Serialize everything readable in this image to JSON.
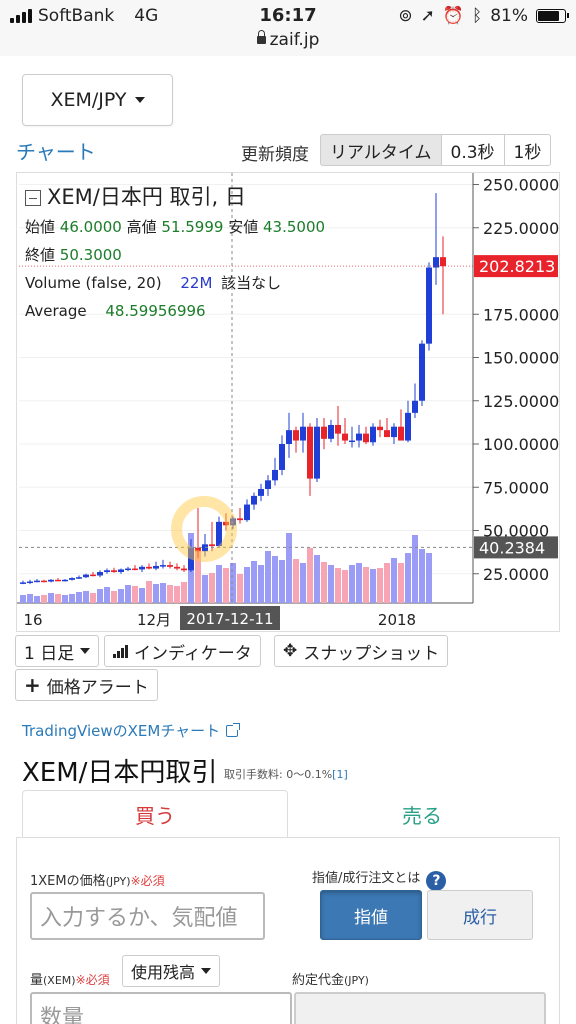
{
  "status_bar": {
    "carrier": "SoftBank",
    "network": "4G",
    "time": "16:17",
    "battery": "81%",
    "battery_level": 0.81,
    "url": "zaif.jp",
    "icons": [
      "signal-icon",
      "orientation-lock-icon",
      "location-icon",
      "alarm-icon",
      "bluetooth-icon",
      "battery-icon",
      "lock-icon"
    ]
  },
  "pair_select": {
    "value": "XEM/JPY"
  },
  "chart_header": {
    "chart_link": "チャート",
    "frequency_label": "更新頻度",
    "frequency_options": [
      "リアルタイム",
      "0.3秒",
      "1秒"
    ],
    "frequency_selected": "リアルタイム"
  },
  "legend": {
    "title": "XEM/日本円 取引, 日",
    "open_label": "始値",
    "open": "46.0000",
    "high_label": "高値",
    "high": "51.5999",
    "low_label": "安値",
    "low": "43.5000",
    "close_label": "終値",
    "close": "50.3000",
    "volume_label": "Volume (false, 20)",
    "volume": "22M",
    "volume_na": "該当なし",
    "average_label": "Average",
    "average": "48.59956996"
  },
  "chart_data": {
    "type": "candlestick",
    "x_ticks": [
      "16",
      "12月",
      "2017-12-11",
      "2018"
    ],
    "x_highlight": "2017-12-11",
    "y_ticks": [
      "250.0000",
      "225.0000",
      "175.0000",
      "150.0000",
      "125.0000",
      "100.0000",
      "75.0000",
      "50.0000",
      "25.0000"
    ],
    "ylim": [
      0,
      255
    ],
    "price_label": "202.8213",
    "price_line": 202.8213,
    "cursor_label": "40.2384",
    "cursor_line": 40.2384,
    "colors": {
      "up": "#1f3fd6",
      "down": "#e8232b",
      "vol_up": "#9a9cf5",
      "vol_down": "#f7a5b4",
      "price_label_bg": "#e8232b",
      "cursor_label_bg": "#555555"
    },
    "candles": [
      {
        "o": 20,
        "h": 21,
        "l": 19,
        "c": 20
      },
      {
        "o": 20,
        "h": 21.5,
        "l": 19,
        "c": 20.5
      },
      {
        "o": 20.5,
        "h": 22,
        "l": 20,
        "c": 21
      },
      {
        "o": 21,
        "h": 21.5,
        "l": 20,
        "c": 20.5
      },
      {
        "o": 20.5,
        "h": 22,
        "l": 20,
        "c": 21.5
      },
      {
        "o": 21.5,
        "h": 22.5,
        "l": 21,
        "c": 21
      },
      {
        "o": 21,
        "h": 22,
        "l": 20.5,
        "c": 21.5
      },
      {
        "o": 21.5,
        "h": 23,
        "l": 21,
        "c": 22.5
      },
      {
        "o": 22.5,
        "h": 24,
        "l": 22,
        "c": 23
      },
      {
        "o": 23,
        "h": 25,
        "l": 22.5,
        "c": 24.5
      },
      {
        "o": 24.5,
        "h": 26,
        "l": 23.5,
        "c": 24
      },
      {
        "o": 24,
        "h": 27,
        "l": 23,
        "c": 26
      },
      {
        "o": 26,
        "h": 28,
        "l": 25,
        "c": 27
      },
      {
        "o": 27,
        "h": 28.5,
        "l": 25.5,
        "c": 26
      },
      {
        "o": 26,
        "h": 28,
        "l": 25,
        "c": 27.5
      },
      {
        "o": 27.5,
        "h": 29,
        "l": 26.5,
        "c": 28
      },
      {
        "o": 28,
        "h": 30,
        "l": 27,
        "c": 27.5
      },
      {
        "o": 27.5,
        "h": 30,
        "l": 26,
        "c": 29
      },
      {
        "o": 29,
        "h": 31,
        "l": 27.5,
        "c": 28
      },
      {
        "o": 28,
        "h": 32,
        "l": 27,
        "c": 29.5
      },
      {
        "o": 29.5,
        "h": 33,
        "l": 28,
        "c": 30
      },
      {
        "o": 30,
        "h": 32,
        "l": 28,
        "c": 29
      },
      {
        "o": 29,
        "h": 31,
        "l": 27,
        "c": 28
      },
      {
        "o": 28,
        "h": 30,
        "l": 26,
        "c": 27
      },
      {
        "o": 27,
        "h": 45,
        "l": 26,
        "c": 40
      },
      {
        "o": 40,
        "h": 63,
        "l": 34,
        "c": 38
      },
      {
        "o": 38,
        "h": 48,
        "l": 35,
        "c": 42
      },
      {
        "o": 42,
        "h": 55,
        "l": 38,
        "c": 41
      },
      {
        "o": 41,
        "h": 58,
        "l": 40,
        "c": 55
      },
      {
        "o": 55,
        "h": 60,
        "l": 50,
        "c": 53
      },
      {
        "o": 53,
        "h": 58,
        "l": 51,
        "c": 57
      },
      {
        "o": 57,
        "h": 63,
        "l": 54,
        "c": 56
      },
      {
        "o": 56,
        "h": 68,
        "l": 55,
        "c": 65
      },
      {
        "o": 65,
        "h": 72,
        "l": 62,
        "c": 70
      },
      {
        "o": 70,
        "h": 77,
        "l": 67,
        "c": 74
      },
      {
        "o": 74,
        "h": 82,
        "l": 70,
        "c": 79
      },
      {
        "o": 79,
        "h": 92,
        "l": 76,
        "c": 85
      },
      {
        "o": 85,
        "h": 105,
        "l": 82,
        "c": 100
      },
      {
        "o": 100,
        "h": 118,
        "l": 92,
        "c": 108
      },
      {
        "o": 108,
        "h": 110,
        "l": 95,
        "c": 102
      },
      {
        "o": 102,
        "h": 118,
        "l": 95,
        "c": 110
      },
      {
        "o": 110,
        "h": 112,
        "l": 70,
        "c": 80
      },
      {
        "o": 80,
        "h": 115,
        "l": 78,
        "c": 110
      },
      {
        "o": 110,
        "h": 115,
        "l": 97,
        "c": 103
      },
      {
        "o": 103,
        "h": 114,
        "l": 101,
        "c": 111
      },
      {
        "o": 111,
        "h": 122,
        "l": 99,
        "c": 106
      },
      {
        "o": 106,
        "h": 115,
        "l": 100,
        "c": 102
      },
      {
        "o": 102,
        "h": 110,
        "l": 98,
        "c": 102
      },
      {
        "o": 102,
        "h": 111,
        "l": 98,
        "c": 106
      },
      {
        "o": 106,
        "h": 110,
        "l": 100,
        "c": 101
      },
      {
        "o": 101,
        "h": 112,
        "l": 99,
        "c": 110
      },
      {
        "o": 110,
        "h": 114,
        "l": 104,
        "c": 108
      },
      {
        "o": 108,
        "h": 115,
        "l": 105,
        "c": 104
      },
      {
        "o": 104,
        "h": 112,
        "l": 100,
        "c": 110
      },
      {
        "o": 110,
        "h": 120,
        "l": 102,
        "c": 102
      },
      {
        "o": 102,
        "h": 125,
        "l": 101,
        "c": 118
      },
      {
        "o": 118,
        "h": 135,
        "l": 115,
        "c": 125
      },
      {
        "o": 125,
        "h": 160,
        "l": 122,
        "c": 158
      },
      {
        "o": 158,
        "h": 205,
        "l": 154,
        "c": 202
      },
      {
        "o": 202,
        "h": 245,
        "l": 192,
        "c": 208
      },
      {
        "o": 208,
        "h": 220,
        "l": 175,
        "c": 202.8
      }
    ],
    "volume": [
      8,
      9,
      7,
      8,
      10,
      9,
      8,
      9,
      11,
      12,
      10,
      14,
      16,
      12,
      14,
      18,
      17,
      15,
      22,
      19,
      20,
      18,
      17,
      21,
      70,
      55,
      28,
      30,
      38,
      35,
      40,
      29,
      36,
      42,
      38,
      52,
      47,
      43,
      70,
      44,
      40,
      55,
      48,
      41,
      38,
      35,
      33,
      38,
      40,
      36,
      34,
      35,
      40,
      45,
      40,
      50,
      68,
      54,
      50
    ]
  },
  "toolbar": {
    "interval": "1 日足",
    "indicators": "インディケータ",
    "snapshot": "スナップショット",
    "price_alert": "価格アラート"
  },
  "tradingview_link": "TradingViewのXEMチャート",
  "trade": {
    "title": "XEM/日本円取引",
    "fee_text": "取引手数料: 0～0.1%",
    "fee_ref": "[1]",
    "tab_buy": "買う",
    "tab_sell": "売る",
    "price_label": "1XEMの価格",
    "price_unit": "(JPY)",
    "required": "※必須",
    "price_placeholder": "入力するか、気配値",
    "order_type_label": "指値/成行注文とは",
    "help": "?",
    "limit_button": "指値",
    "market_button": "成行",
    "amount_label": "量",
    "amount_unit": "(XEM)",
    "balance_select": "使用残高",
    "amount_placeholder": "数量",
    "total_label": "約定代金",
    "total_unit": "(JPY)"
  }
}
